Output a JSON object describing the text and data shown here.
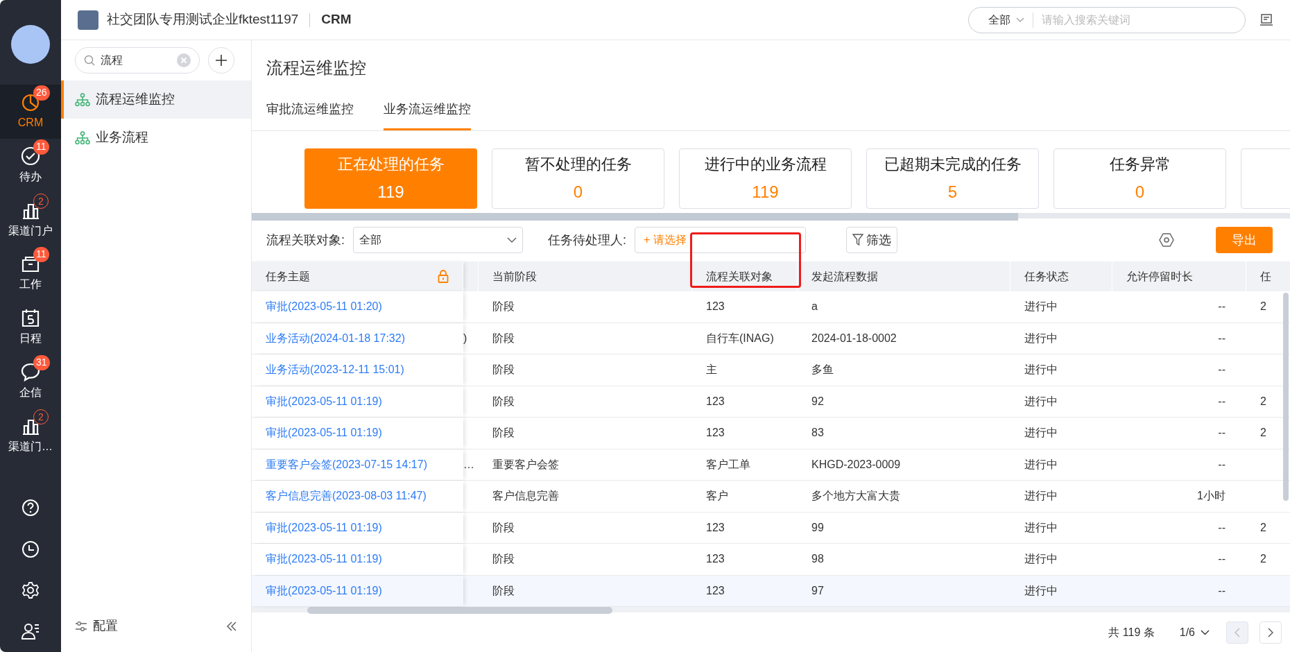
{
  "header": {
    "company": "社交团队专用测试企业fktest1197",
    "app": "CRM",
    "search_scope": "全部",
    "search_placeholder": "请输入搜索关键词"
  },
  "rail": {
    "items": [
      {
        "kind": "chart",
        "label": "CRM",
        "badge": "26",
        "badge_outlined": false,
        "selected": true
      },
      {
        "kind": "check",
        "label": "待办",
        "badge": "11",
        "badge_outlined": false,
        "selected": false
      },
      {
        "kind": "building",
        "label": "渠道门户",
        "badge": "2",
        "badge_outlined": true,
        "selected": false
      },
      {
        "kind": "box",
        "label": "工作",
        "badge": "11",
        "badge_outlined": false,
        "selected": false
      },
      {
        "kind": "calendar",
        "label": "日程",
        "selected": false
      },
      {
        "kind": "chat",
        "label": "企信",
        "badge": "31",
        "badge_outlined": false,
        "selected": false
      },
      {
        "kind": "building",
        "label": "渠道门…",
        "badge": "2",
        "badge_outlined": true,
        "selected": false
      }
    ]
  },
  "sidebar": {
    "search_value": "流程",
    "items": [
      {
        "label": "流程运维监控",
        "selected": true
      },
      {
        "label": "业务流程",
        "selected": false
      }
    ],
    "config": "配置"
  },
  "page": {
    "title": "流程运维监控",
    "tabs": [
      {
        "label": "审批流运维监控",
        "selected": false
      },
      {
        "label": "业务流运维监控",
        "selected": true
      }
    ]
  },
  "cards": [
    {
      "label": "正在处理的任务",
      "value": "119",
      "selected": true
    },
    {
      "label": "暂不处理的任务",
      "value": "0",
      "selected": false
    },
    {
      "label": "进行中的业务流程",
      "value": "119",
      "selected": false
    },
    {
      "label": "已超期未完成的任务",
      "value": "5",
      "selected": false
    },
    {
      "label": "任务异常",
      "value": "0",
      "selected": false
    }
  ],
  "filters": {
    "object_label": "流程关联对象:",
    "object_value": "全部",
    "assignee_label": "任务待处理人:",
    "assignee_placeholder": "+ 请选择",
    "filter_button": "筛选",
    "export_button": "导出"
  },
  "table": {
    "columns": [
      "任务主题",
      "当前阶段",
      "流程关联对象",
      "发起流程数据",
      "任务状态",
      "允许停留时长",
      "任"
    ],
    "rows": [
      {
        "subject": "审批(2023-05-11 01:20)",
        "stage": "阶段",
        "object": "123",
        "data": "a",
        "status": "进行中",
        "duration": "--",
        "column_8": "2"
      },
      {
        "subject": "业务活动(2024-01-18 17:32)",
        "column_2": ")",
        "stage": "阶段",
        "object": "自行车(INAG)",
        "data": "2024-01-18-0002",
        "status": "进行中",
        "duration": "--"
      },
      {
        "subject": "业务活动(2023-12-11 15:01)",
        "stage": "阶段",
        "object": "主",
        "data": "多鱼",
        "status": "进行中",
        "duration": "--"
      },
      {
        "subject": "审批(2023-05-11 01:19)",
        "stage": "阶段",
        "object": "123",
        "data": "92",
        "status": "进行中",
        "duration": "--",
        "column_8": "2"
      },
      {
        "subject": "审批(2023-05-11 01:19)",
        "stage": "阶段",
        "object": "123",
        "data": "83",
        "status": "进行中",
        "duration": "--",
        "column_8": "2"
      },
      {
        "subject": "重要客户会签(2023-07-15 14:17)",
        "column_2": "…",
        "stage": "重要客户会签",
        "object": "客户工单",
        "data": "KHGD-2023-0009",
        "status": "进行中",
        "duration": "--"
      },
      {
        "subject": "客户信息完善(2023-08-03 11:47)",
        "stage": "客户信息完善",
        "object": "客户",
        "data": "多个地方大富大贵",
        "status": "进行中",
        "duration": "1小时"
      },
      {
        "subject": "审批(2023-05-11 01:19)",
        "stage": "阶段",
        "object": "123",
        "data": "99",
        "status": "进行中",
        "duration": "--",
        "column_8": "2"
      },
      {
        "subject": "审批(2023-05-11 01:19)",
        "stage": "阶段",
        "object": "123",
        "data": "98",
        "status": "进行中",
        "duration": "--",
        "column_8": "2"
      },
      {
        "subject": "审批(2023-05-11 01:19)",
        "stage": "阶段",
        "object": "123",
        "data": "97",
        "status": "进行中",
        "duration": "--"
      }
    ]
  },
  "pagination": {
    "total": "共 119 条",
    "page": "1/6"
  }
}
